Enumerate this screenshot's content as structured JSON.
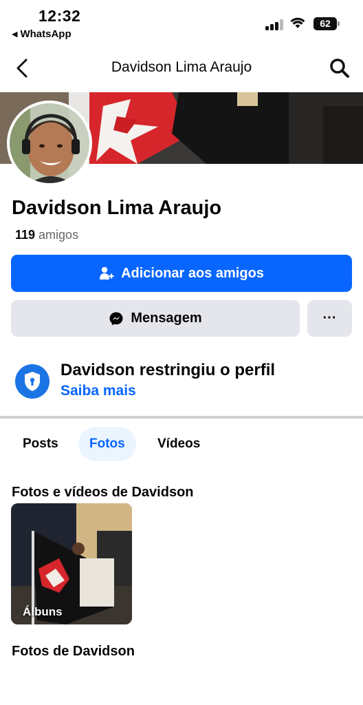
{
  "status_bar": {
    "time": "12:32",
    "back_app": "WhatsApp",
    "battery": "62"
  },
  "nav": {
    "title": "Davidson Lima Araujo"
  },
  "profile": {
    "name": "Davidson Lima Araujo",
    "friends_count": "119",
    "friends_label": "amigos"
  },
  "actions": {
    "add_friend_label": "Adicionar aos amigos",
    "message_label": "Mensagem",
    "more_label": "···"
  },
  "restricted": {
    "title": "Davidson restringiu o perfil",
    "link": "Saiba mais"
  },
  "tabs": [
    {
      "label": "Posts",
      "selected": false
    },
    {
      "label": "Fotos",
      "selected": true
    },
    {
      "label": "Vídeos",
      "selected": false
    }
  ],
  "photos": {
    "section_title": "Fotos e vídeos de Davidson",
    "album_label": "Álbuns",
    "section_title_2": "Fotos de Davidson"
  },
  "colors": {
    "accent": "#0866ff",
    "button_gray": "#e4e6eb",
    "secondary_text": "#65676b"
  }
}
